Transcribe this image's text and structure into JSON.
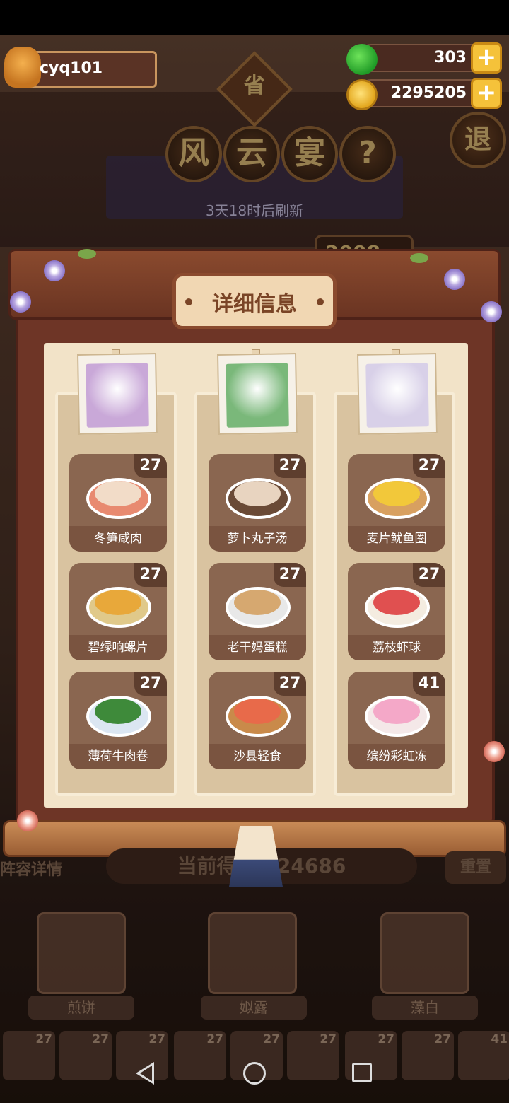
{
  "player": {
    "name": "cyq101"
  },
  "resources": {
    "apples": "303",
    "coins": "2295205",
    "plus_symbol": "+"
  },
  "header": {
    "province_badge": "省",
    "title_chars": [
      "风",
      "云",
      "宴"
    ],
    "help_symbol": "?",
    "quit_label": "退",
    "refresh_text": "3天18时后刷新",
    "score_tag": "2008"
  },
  "modal": {
    "title": "详细信息",
    "columns": [
      {
        "portrait_color": "#c9a8d8",
        "dishes": [
          {
            "name": "冬笋咸肉",
            "level": "27",
            "plate": "#e88a70",
            "food": "#f2dcc8"
          },
          {
            "name": "碧绿响螺片",
            "level": "27",
            "plate": "#e0c98a",
            "food": "#e8a83a"
          },
          {
            "name": "薄荷牛肉卷",
            "level": "27",
            "plate": "#dbe6f2",
            "food": "#3e8a3a"
          }
        ]
      },
      {
        "portrait_color": "#7ab87a",
        "dishes": [
          {
            "name": "萝卜丸子汤",
            "level": "27",
            "plate": "#6a4a36",
            "food": "#e8d4c0"
          },
          {
            "name": "老干妈蛋糕",
            "level": "27",
            "plate": "#e8e8e8",
            "food": "#d6a870"
          },
          {
            "name": "沙县轻食",
            "level": "27",
            "plate": "#c98a4a",
            "food": "#e86a4a"
          }
        ]
      },
      {
        "portrait_color": "#d8d0e8",
        "dishes": [
          {
            "name": "麦片鱿鱼圈",
            "level": "27",
            "plate": "#d8a060",
            "food": "#f2c83a"
          },
          {
            "name": "荔枝虾球",
            "level": "27",
            "plate": "#f4ece0",
            "food": "#e05050"
          },
          {
            "name": "缤纷彩虹冻",
            "level": "41",
            "plate": "#f4e8e8",
            "food": "#f4a8c8"
          }
        ]
      }
    ]
  },
  "bottom": {
    "left_label": "阵容详情",
    "score_text": "当前得分 124686",
    "right_label": "重置",
    "chefs": [
      "煎饼",
      "姒露",
      "藻白"
    ],
    "mini_dish_levels": [
      "27",
      "27",
      "27",
      "27",
      "27",
      "27",
      "27",
      "27",
      "41"
    ]
  }
}
